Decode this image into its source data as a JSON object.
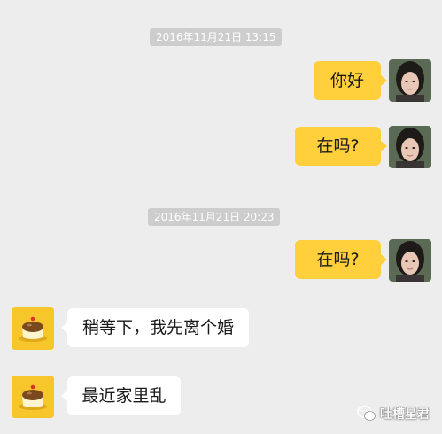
{
  "chat": {
    "timestamps": [
      "2016年11月21日 13:15",
      "2016年11月21日 20:23"
    ],
    "messages": [
      {
        "side": "right",
        "sender": "user",
        "text": "你好"
      },
      {
        "side": "right",
        "sender": "user",
        "text": "在吗?"
      },
      {
        "side": "right",
        "sender": "user",
        "text": "在吗?"
      },
      {
        "side": "left",
        "sender": "contact",
        "text": "稍等下，我先离个婚"
      },
      {
        "side": "left",
        "sender": "contact",
        "text": "最近家里乱"
      }
    ]
  },
  "watermark": {
    "text": "吐槽星君",
    "icon": "wechat-icon"
  },
  "colors": {
    "background": "#ededed",
    "outgoing_bubble": "#ffcf3c",
    "incoming_bubble": "#ffffff",
    "timestamp_bg": "#cdcdcd",
    "contact_avatar_bg": "#f7c62a"
  }
}
